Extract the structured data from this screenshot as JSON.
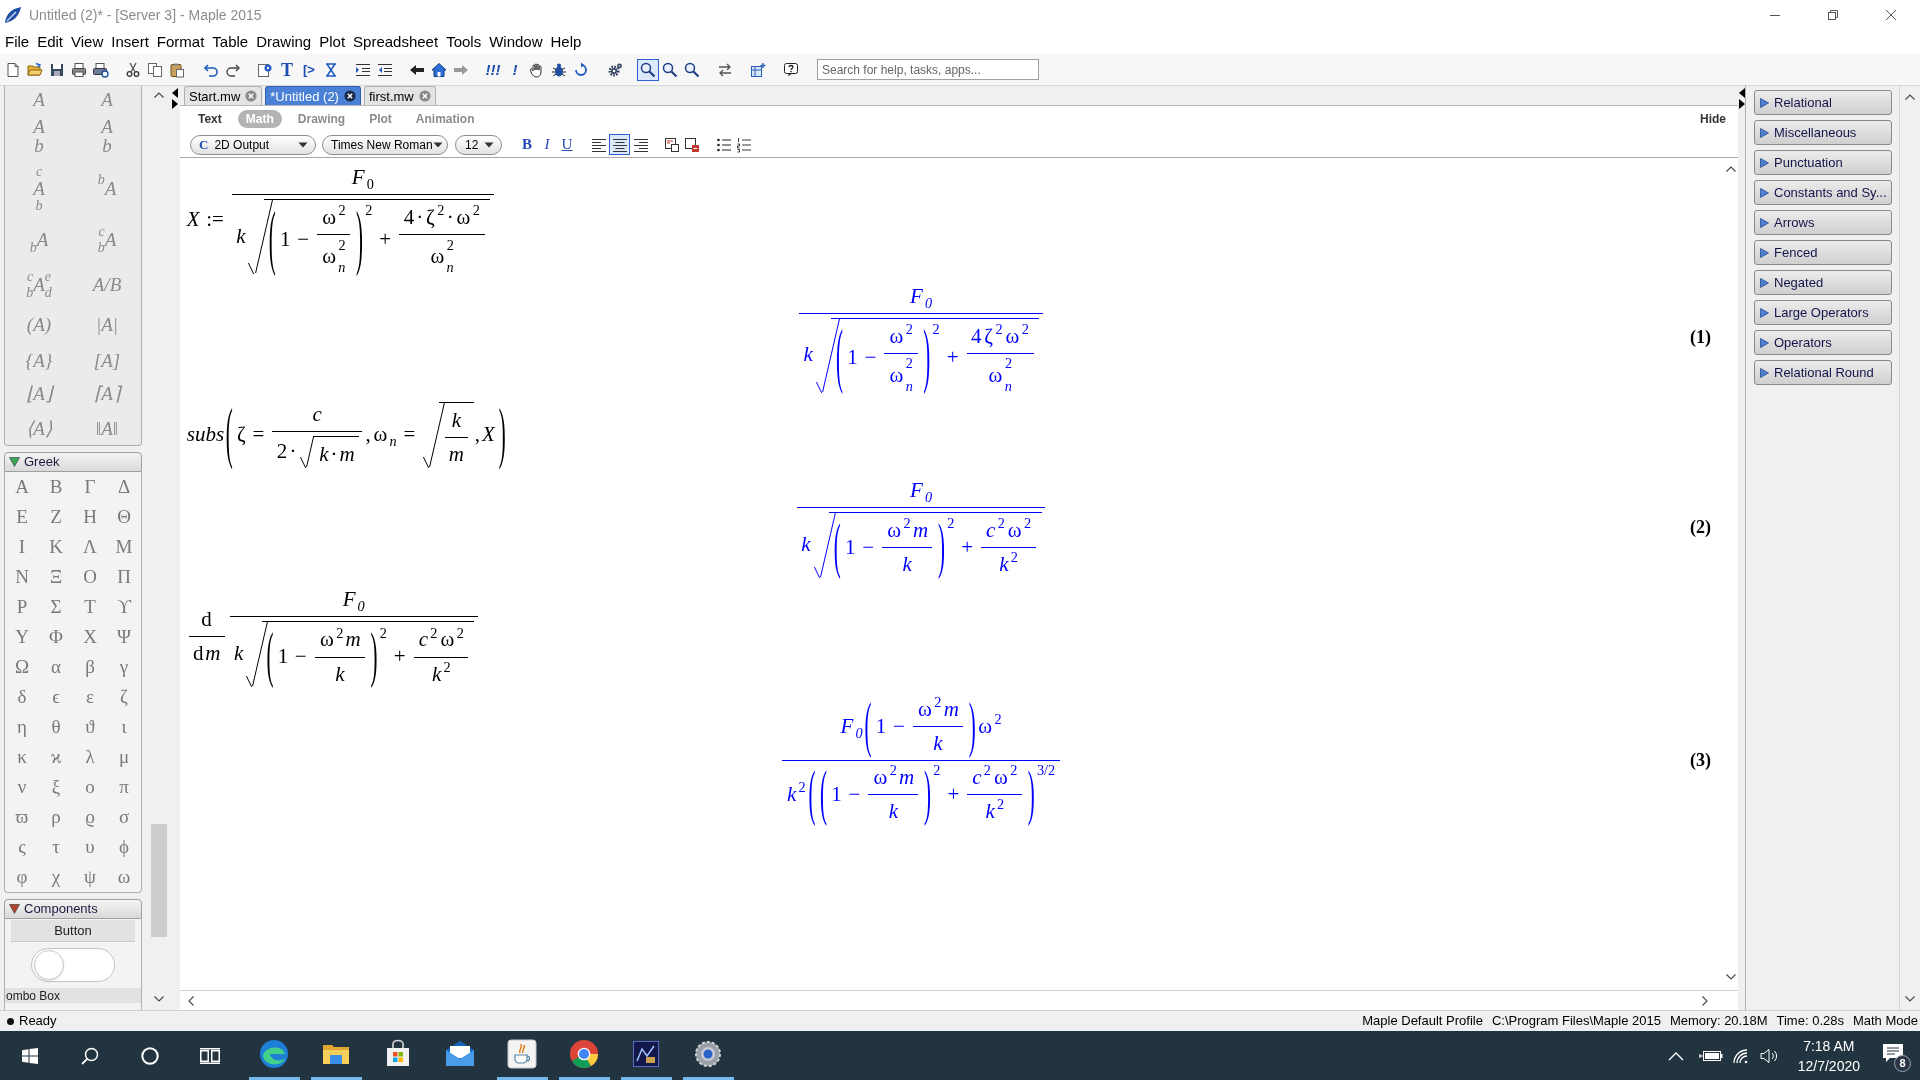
{
  "window": {
    "title": "Untitled (2)* - [Server 3] - Maple 2015"
  },
  "menu": [
    "File",
    "Edit",
    "View",
    "Insert",
    "Format",
    "Table",
    "Drawing",
    "Plot",
    "Spreadsheet",
    "Tools",
    "Window",
    "Help"
  ],
  "toolbar": {
    "text_tools": [
      "T",
      "[>",
      "!!!",
      "!"
    ],
    "zoom_buttons": [
      {
        "selected": true
      },
      {
        "selected": false
      },
      {
        "selected": false
      }
    ],
    "search": {
      "placeholder": "Search for help, tasks, apps..."
    }
  },
  "left_palette": {
    "layout_items": [
      {
        "kind": "text",
        "text": "A"
      },
      {
        "kind": "text",
        "text": "A"
      },
      {
        "kind": "stack",
        "lines": [
          "A",
          "b"
        ]
      },
      {
        "kind": "stack",
        "lines": [
          "A",
          "b"
        ]
      },
      {
        "kind": "stack",
        "lines": [
          "c",
          "A",
          "b"
        ]
      },
      {
        "kind": "scripts",
        "base": "A",
        "presup": "b"
      },
      {
        "kind": "scripts",
        "base": "A",
        "presub": "b"
      },
      {
        "kind": "scripts",
        "base": "A",
        "presup": "c",
        "presub": "b"
      },
      {
        "kind": "scripts",
        "base": "A",
        "presup": "c",
        "presub": "b",
        "sup": "e",
        "sub": "d"
      },
      {
        "kind": "text",
        "text": "A/B"
      },
      {
        "kind": "text",
        "text": "(A)"
      },
      {
        "kind": "text",
        "text": "|A|"
      },
      {
        "kind": "text",
        "text": "{A}"
      },
      {
        "kind": "text",
        "text": "[A]"
      },
      {
        "kind": "text",
        "text": "⌊A⌋"
      },
      {
        "kind": "text",
        "text": "⌈A⌉"
      },
      {
        "kind": "text",
        "text": "⟨A⟩"
      },
      {
        "kind": "text",
        "text": "‖A‖"
      }
    ],
    "sections": [
      {
        "kind": "symbols",
        "title": "Greek",
        "expanded": true,
        "color": "#3aa655",
        "symbols": [
          "Α",
          "Β",
          "Γ",
          "Δ",
          "Ε",
          "Ζ",
          "Η",
          "Θ",
          "Ι",
          "Κ",
          "Λ",
          "Μ",
          "Ν",
          "Ξ",
          "Ο",
          "Π",
          "Ρ",
          "Σ",
          "Τ",
          "ϒ",
          "Υ",
          "Φ",
          "Χ",
          "Ψ",
          "Ω",
          "α",
          "β",
          "γ",
          "δ",
          "ϵ",
          "ε",
          "ζ",
          "η",
          "θ",
          "ϑ",
          "ι",
          "κ",
          "ϰ",
          "λ",
          "μ",
          "ν",
          "ξ",
          "ο",
          "π",
          "ϖ",
          "ρ",
          "ϱ",
          "σ",
          "ς",
          "τ",
          "υ",
          "ϕ",
          "φ",
          "χ",
          "ψ",
          "ω"
        ]
      },
      {
        "kind": "components",
        "title": "Components",
        "expanded": true,
        "color": "#b0452c",
        "items": [
          {
            "kind": "button",
            "label": "Button"
          },
          {
            "kind": "toggle",
            "on": false
          },
          {
            "kind": "combo",
            "label": "ombo Box"
          }
        ]
      }
    ]
  },
  "document_tabs": [
    {
      "label": "Start.mw",
      "selected": false
    },
    {
      "label": "*Untitled (2)",
      "selected": true
    },
    {
      "label": "first.mw",
      "selected": false
    }
  ],
  "context_bar": {
    "tabs": [
      {
        "label": "Text",
        "selected": false,
        "disabled": false
      },
      {
        "label": "Math",
        "selected": true,
        "disabled": false
      },
      {
        "label": "Drawing",
        "selected": false,
        "disabled": true
      },
      {
        "label": "Plot",
        "selected": false,
        "disabled": true
      },
      {
        "label": "Animation",
        "selected": false,
        "disabled": true
      }
    ],
    "hide": "Hide"
  },
  "format_bar": {
    "style_glyph": "C",
    "style": "2D Output",
    "font": "Times New Roman",
    "size": "12",
    "text_styles": [
      "B",
      "I",
      "U"
    ],
    "alignment": [
      {
        "selected": false
      },
      {
        "selected": true
      },
      {
        "selected": false
      }
    ]
  },
  "document": {
    "regions": [
      {
        "kind": "input",
        "math": [
          {
            "kind": "mi",
            "text": "X"
          },
          {
            "kind": "mo",
            "text": ":="
          },
          {
            "kind": "frac",
            "num": [
              {
                "kind": "scr",
                "base": [
                  {
                    "kind": "mi",
                    "text": "F"
                  }
                ],
                "sub": [
                  {
                    "kind": "mn",
                    "text": "0"
                  }
                ]
              }
            ],
            "den": [
              {
                "kind": "mi",
                "text": "k"
              },
              {
                "kind": "sqrt",
                "body": [
                  {
                    "kind": "scr",
                    "base": [
                      {
                        "kind": "fence",
                        "open": "(",
                        "close": ")",
                        "body": [
                          {
                            "kind": "mn",
                            "text": "1"
                          },
                          {
                            "kind": "mo",
                            "text": "−"
                          },
                          {
                            "kind": "frac",
                            "num": [
                              {
                                "kind": "scr",
                                "base": [
                                  {
                                    "kind": "mn",
                                    "text": "ω"
                                  }
                                ],
                                "sup": [
                                  {
                                    "kind": "mn",
                                    "text": "2"
                                  }
                                ]
                              }
                            ],
                            "den": [
                              {
                                "kind": "scr",
                                "base": [
                                  {
                                    "kind": "mn",
                                    "text": "ω"
                                  }
                                ],
                                "sup": [
                                  {
                                    "kind": "mn",
                                    "text": "2"
                                  }
                                ],
                                "sub": [
                                  {
                                    "kind": "mi",
                                    "text": "n"
                                  }
                                ]
                              }
                            ]
                          }
                        ]
                      }
                    ],
                    "sup": [
                      {
                        "kind": "mn",
                        "text": "2"
                      }
                    ]
                  },
                  {
                    "kind": "mo",
                    "text": "+"
                  },
                  {
                    "kind": "frac",
                    "num": [
                      {
                        "kind": "mn",
                        "text": "4"
                      },
                      {
                        "kind": "mn",
                        "text": "·"
                      },
                      {
                        "kind": "scr",
                        "base": [
                          {
                            "kind": "mn",
                            "text": "ζ"
                          }
                        ],
                        "sup": [
                          {
                            "kind": "mn",
                            "text": "2"
                          }
                        ]
                      },
                      {
                        "kind": "mn",
                        "text": "·"
                      },
                      {
                        "kind": "scr",
                        "base": [
                          {
                            "kind": "mn",
                            "text": "ω"
                          }
                        ],
                        "sup": [
                          {
                            "kind": "mn",
                            "text": "2"
                          }
                        ]
                      }
                    ],
                    "den": [
                      {
                        "kind": "scr",
                        "base": [
                          {
                            "kind": "mn",
                            "text": "ω"
                          }
                        ],
                        "sup": [
                          {
                            "kind": "mn",
                            "text": "2"
                          }
                        ],
                        "sub": [
                          {
                            "kind": "mi",
                            "text": "n"
                          }
                        ]
                      }
                    ]
                  }
                ]
              }
            ]
          }
        ]
      },
      {
        "kind": "output",
        "label": "(1)",
        "math": [
          {
            "kind": "frac",
            "num": [
              {
                "kind": "scr",
                "base": [
                  {
                    "kind": "mi",
                    "text": "F"
                  }
                ],
                "sub": [
                  {
                    "kind": "mi",
                    "text": "0"
                  }
                ]
              }
            ],
            "den": [
              {
                "kind": "mi",
                "text": "k"
              },
              {
                "kind": "sqrt",
                "body": [
                  {
                    "kind": "scr",
                    "base": [
                      {
                        "kind": "fence",
                        "open": "(",
                        "close": ")",
                        "body": [
                          {
                            "kind": "mn",
                            "text": "1"
                          },
                          {
                            "kind": "mo",
                            "text": "−"
                          },
                          {
                            "kind": "frac",
                            "num": [
                              {
                                "kind": "scr",
                                "base": [
                                  {
                                    "kind": "mn",
                                    "text": "ω"
                                  }
                                ],
                                "sup": [
                                  {
                                    "kind": "mn",
                                    "text": "2"
                                  }
                                ]
                              }
                            ],
                            "den": [
                              {
                                "kind": "scr",
                                "base": [
                                  {
                                    "kind": "mn",
                                    "text": "ω"
                                  }
                                ],
                                "sup": [
                                  {
                                    "kind": "mn",
                                    "text": "2"
                                  }
                                ],
                                "sub": [
                                  {
                                    "kind": "mi",
                                    "text": "n"
                                  }
                                ]
                              }
                            ]
                          }
                        ]
                      }
                    ],
                    "sup": [
                      {
                        "kind": "mn",
                        "text": "2"
                      }
                    ]
                  },
                  {
                    "kind": "mo",
                    "text": "+"
                  },
                  {
                    "kind": "frac",
                    "num": [
                      {
                        "kind": "mn",
                        "text": "4"
                      },
                      {
                        "kind": "scr",
                        "base": [
                          {
                            "kind": "mn",
                            "text": "ζ"
                          }
                        ],
                        "sup": [
                          {
                            "kind": "mn",
                            "text": "2"
                          }
                        ]
                      },
                      {
                        "kind": "scr",
                        "base": [
                          {
                            "kind": "mn",
                            "text": "ω"
                          }
                        ],
                        "sup": [
                          {
                            "kind": "mn",
                            "text": "2"
                          }
                        ]
                      }
                    ],
                    "den": [
                      {
                        "kind": "scr",
                        "base": [
                          {
                            "kind": "mn",
                            "text": "ω"
                          }
                        ],
                        "sup": [
                          {
                            "kind": "mn",
                            "text": "2"
                          }
                        ],
                        "sub": [
                          {
                            "kind": "mi",
                            "text": "n"
                          }
                        ]
                      }
                    ]
                  }
                ]
              }
            ]
          }
        ]
      },
      {
        "kind": "input",
        "math": [
          {
            "kind": "mi",
            "text": "subs"
          },
          {
            "kind": "fence",
            "open": "(",
            "close": ")",
            "body": [
              {
                "kind": "mn",
                "text": "ζ"
              },
              {
                "kind": "mo",
                "text": "="
              },
              {
                "kind": "frac",
                "num": [
                  {
                    "kind": "mi",
                    "text": "c"
                  }
                ],
                "den": [
                  {
                    "kind": "mn",
                    "text": "2"
                  },
                  {
                    "kind": "mn",
                    "text": "·"
                  },
                  {
                    "kind": "sqrt",
                    "body": [
                      {
                        "kind": "mi",
                        "text": "k"
                      },
                      {
                        "kind": "mn",
                        "text": "·"
                      },
                      {
                        "kind": "mi",
                        "text": "m"
                      }
                    ]
                  }
                ]
              },
              {
                "kind": "mn",
                "text": ","
              },
              {
                "kind": "scr",
                "base": [
                  {
                    "kind": "mn",
                    "text": "ω"
                  }
                ],
                "sub": [
                  {
                    "kind": "mi",
                    "text": "n"
                  }
                ]
              },
              {
                "kind": "mo",
                "text": "="
              },
              {
                "kind": "sqrt",
                "body": [
                  {
                    "kind": "frac",
                    "num": [
                      {
                        "kind": "mi",
                        "text": "k"
                      }
                    ],
                    "den": [
                      {
                        "kind": "mi",
                        "text": "m"
                      }
                    ]
                  }
                ]
              },
              {
                "kind": "mn",
                "text": ","
              },
              {
                "kind": "mi",
                "text": "X"
              }
            ]
          }
        ]
      },
      {
        "kind": "output",
        "label": "(2)",
        "math": [
          {
            "kind": "frac",
            "num": [
              {
                "kind": "scr",
                "base": [
                  {
                    "kind": "mi",
                    "text": "F"
                  }
                ],
                "sub": [
                  {
                    "kind": "mi",
                    "text": "0"
                  }
                ]
              }
            ],
            "den": [
              {
                "kind": "mi",
                "text": "k"
              },
              {
                "kind": "sqrt",
                "body": [
                  {
                    "kind": "scr",
                    "base": [
                      {
                        "kind": "fence",
                        "open": "(",
                        "close": ")",
                        "body": [
                          {
                            "kind": "mn",
                            "text": "1"
                          },
                          {
                            "kind": "mo",
                            "text": "−"
                          },
                          {
                            "kind": "frac",
                            "num": [
                              {
                                "kind": "scr",
                                "base": [
                                  {
                                    "kind": "mn",
                                    "text": "ω"
                                  }
                                ],
                                "sup": [
                                  {
                                    "kind": "mn",
                                    "text": "2"
                                  }
                                ]
                              },
                              {
                                "kind": "mi",
                                "text": "m"
                              }
                            ],
                            "den": [
                              {
                                "kind": "mi",
                                "text": "k"
                              }
                            ]
                          }
                        ]
                      }
                    ],
                    "sup": [
                      {
                        "kind": "mn",
                        "text": "2"
                      }
                    ]
                  },
                  {
                    "kind": "mo",
                    "text": "+"
                  },
                  {
                    "kind": "frac",
                    "num": [
                      {
                        "kind": "scr",
                        "base": [
                          {
                            "kind": "mi",
                            "text": "c"
                          }
                        ],
                        "sup": [
                          {
                            "kind": "mn",
                            "text": "2"
                          }
                        ]
                      },
                      {
                        "kind": "scr",
                        "base": [
                          {
                            "kind": "mn",
                            "text": "ω"
                          }
                        ],
                        "sup": [
                          {
                            "kind": "mn",
                            "text": "2"
                          }
                        ]
                      }
                    ],
                    "den": [
                      {
                        "kind": "scr",
                        "base": [
                          {
                            "kind": "mi",
                            "text": "k"
                          }
                        ],
                        "sup": [
                          {
                            "kind": "mn",
                            "text": "2"
                          }
                        ]
                      }
                    ]
                  }
                ]
              }
            ]
          }
        ]
      },
      {
        "kind": "input",
        "math": [
          {
            "kind": "frac",
            "num": [
              {
                "kind": "mn",
                "text": "d"
              }
            ],
            "den": [
              {
                "kind": "mn",
                "text": "d"
              },
              {
                "kind": "mi",
                "text": "m"
              }
            ]
          },
          {
            "kind": "frac",
            "num": [
              {
                "kind": "scr",
                "base": [
                  {
                    "kind": "mi",
                    "text": "F"
                  }
                ],
                "sub": [
                  {
                    "kind": "mi",
                    "text": "0"
                  }
                ]
              }
            ],
            "den": [
              {
                "kind": "mi",
                "text": "k"
              },
              {
                "kind": "sqrt",
                "body": [
                  {
                    "kind": "scr",
                    "base": [
                      {
                        "kind": "fence",
                        "open": "(",
                        "close": ")",
                        "body": [
                          {
                            "kind": "mn",
                            "text": "1"
                          },
                          {
                            "kind": "mo",
                            "text": "−"
                          },
                          {
                            "kind": "frac",
                            "num": [
                              {
                                "kind": "scr",
                                "base": [
                                  {
                                    "kind": "mn",
                                    "text": "ω"
                                  }
                                ],
                                "sup": [
                                  {
                                    "kind": "mn",
                                    "text": "2"
                                  }
                                ]
                              },
                              {
                                "kind": "mi",
                                "text": "m"
                              }
                            ],
                            "den": [
                              {
                                "kind": "mi",
                                "text": "k"
                              }
                            ]
                          }
                        ]
                      }
                    ],
                    "sup": [
                      {
                        "kind": "mn",
                        "text": "2"
                      }
                    ]
                  },
                  {
                    "kind": "mo",
                    "text": "+"
                  },
                  {
                    "kind": "frac",
                    "num": [
                      {
                        "kind": "scr",
                        "base": [
                          {
                            "kind": "mi",
                            "text": "c"
                          }
                        ],
                        "sup": [
                          {
                            "kind": "mn",
                            "text": "2"
                          }
                        ]
                      },
                      {
                        "kind": "scr",
                        "base": [
                          {
                            "kind": "mn",
                            "text": "ω"
                          }
                        ],
                        "sup": [
                          {
                            "kind": "mn",
                            "text": "2"
                          }
                        ]
                      }
                    ],
                    "den": [
                      {
                        "kind": "scr",
                        "base": [
                          {
                            "kind": "mi",
                            "text": "k"
                          }
                        ],
                        "sup": [
                          {
                            "kind": "mn",
                            "text": "2"
                          }
                        ]
                      }
                    ]
                  }
                ]
              }
            ]
          }
        ]
      },
      {
        "kind": "output",
        "label": "(3)",
        "math": [
          {
            "kind": "frac",
            "num": [
              {
                "kind": "scr",
                "base": [
                  {
                    "kind": "mi",
                    "text": "F"
                  }
                ],
                "sub": [
                  {
                    "kind": "mi",
                    "text": "0"
                  }
                ]
              },
              {
                "kind": "fence",
                "open": "(",
                "close": ")",
                "body": [
                  {
                    "kind": "mn",
                    "text": "1"
                  },
                  {
                    "kind": "mo",
                    "text": "−"
                  },
                  {
                    "kind": "frac",
                    "num": [
                      {
                        "kind": "scr",
                        "base": [
                          {
                            "kind": "mn",
                            "text": "ω"
                          }
                        ],
                        "sup": [
                          {
                            "kind": "mn",
                            "text": "2"
                          }
                        ]
                      },
                      {
                        "kind": "mi",
                        "text": "m"
                      }
                    ],
                    "den": [
                      {
                        "kind": "mi",
                        "text": "k"
                      }
                    ]
                  }
                ]
              },
              {
                "kind": "scr",
                "base": [
                  {
                    "kind": "mn",
                    "text": "ω"
                  }
                ],
                "sup": [
                  {
                    "kind": "mn",
                    "text": "2"
                  }
                ]
              }
            ],
            "den": [
              {
                "kind": "scr",
                "base": [
                  {
                    "kind": "mi",
                    "text": "k"
                  }
                ],
                "sup": [
                  {
                    "kind": "mn",
                    "text": "2"
                  }
                ]
              },
              {
                "kind": "scr",
                "base": [
                  {
                    "kind": "fence",
                    "open": "(",
                    "close": ")",
                    "body": [
                      {
                        "kind": "scr",
                        "base": [
                          {
                            "kind": "fence",
                            "open": "(",
                            "close": ")",
                            "body": [
                              {
                                "kind": "mn",
                                "text": "1"
                              },
                              {
                                "kind": "mo",
                                "text": "−"
                              },
                              {
                                "kind": "frac",
                                "num": [
                                  {
                                    "kind": "scr",
                                    "base": [
                                      {
                                        "kind": "mn",
                                        "text": "ω"
                                      }
                                    ],
                                    "sup": [
                                      {
                                        "kind": "mn",
                                        "text": "2"
                                      }
                                    ]
                                  },
                                  {
                                    "kind": "mi",
                                    "text": "m"
                                  }
                                ],
                                "den": [
                                  {
                                    "kind": "mi",
                                    "text": "k"
                                  }
                                ]
                              }
                            ]
                          }
                        ],
                        "sup": [
                          {
                            "kind": "mn",
                            "text": "2"
                          }
                        ]
                      },
                      {
                        "kind": "mo",
                        "text": "+"
                      },
                      {
                        "kind": "frac",
                        "num": [
                          {
                            "kind": "scr",
                            "base": [
                              {
                                "kind": "mi",
                                "text": "c"
                              }
                            ],
                            "sup": [
                              {
                                "kind": "mn",
                                "text": "2"
                              }
                            ]
                          },
                          {
                            "kind": "scr",
                            "base": [
                              {
                                "kind": "mn",
                                "text": "ω"
                              }
                            ],
                            "sup": [
                              {
                                "kind": "mn",
                                "text": "2"
                              }
                            ]
                          }
                        ],
                        "den": [
                          {
                            "kind": "scr",
                            "base": [
                              {
                                "kind": "mi",
                                "text": "k"
                              }
                            ],
                            "sup": [
                              {
                                "kind": "mn",
                                "text": "2"
                              }
                            ]
                          }
                        ]
                      }
                    ]
                  }
                ],
                "sup": [
                  {
                    "kind": "mn",
                    "text": "3/2"
                  }
                ]
              }
            ]
          }
        ]
      }
    ]
  },
  "right_palette": [
    {
      "title": "Relational",
      "expanded": false
    },
    {
      "title": "Miscellaneous",
      "expanded": false
    },
    {
      "title": "Punctuation",
      "expanded": false
    },
    {
      "title": "Constants and Sy...",
      "expanded": false
    },
    {
      "title": "Arrows",
      "expanded": false
    },
    {
      "title": "Fenced",
      "expanded": false
    },
    {
      "title": "Negated",
      "expanded": false
    },
    {
      "title": "Large Operators",
      "expanded": false
    },
    {
      "title": "Operators",
      "expanded": false
    },
    {
      "title": "Relational Round",
      "expanded": false
    }
  ],
  "status_bar": {
    "state": "Ready",
    "items": [
      "Maple Default Profile",
      "C:\\Program Files\\Maple 2015",
      "Memory: 20.18M",
      "Time: 0.28s",
      "Math Mode"
    ]
  },
  "taskbar": {
    "apps": [
      {
        "running": true
      },
      {
        "running": true
      },
      {
        "running": false
      },
      {
        "running": false
      },
      {
        "running": true
      },
      {
        "running": true
      },
      {
        "running": true
      },
      {
        "running": true
      }
    ],
    "clock": {
      "time": "7:18 AM",
      "date": "12/7/2020"
    },
    "notifications": "8"
  }
}
